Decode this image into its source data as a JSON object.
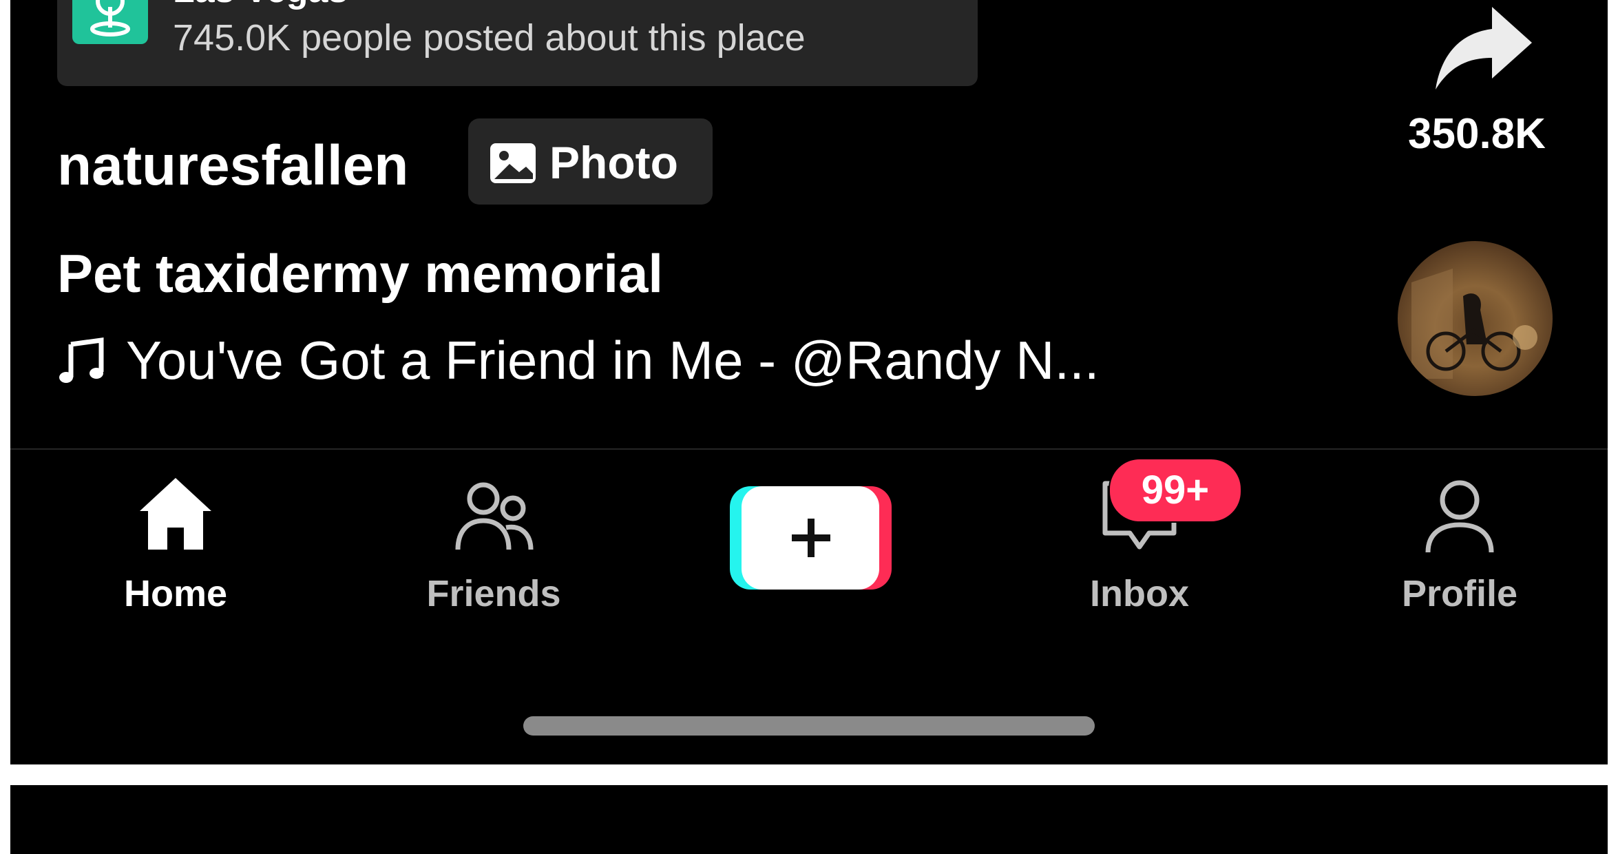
{
  "location": {
    "title": "Las Vegas",
    "subtitle": "745.0K people posted about this place"
  },
  "share": {
    "count": "350.8K"
  },
  "post": {
    "username": "naturesfallen",
    "badge_label": "Photo",
    "caption": "Pet taxidermy memorial",
    "music": "You've Got a Friend in Me - @Randy N..."
  },
  "nav": {
    "home": "Home",
    "friends": "Friends",
    "inbox": "Inbox",
    "profile": "Profile",
    "inbox_badge": "99+"
  },
  "colors": {
    "background": "#000000",
    "accent_red": "#fe2c55",
    "accent_cyan": "#25f4ee",
    "location_green": "#20c39a"
  }
}
